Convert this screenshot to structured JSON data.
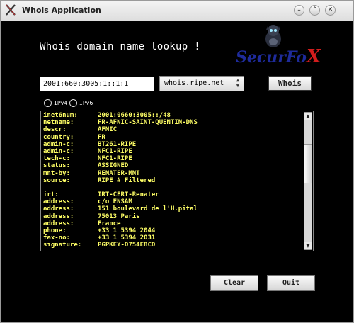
{
  "window": {
    "title": "Whois Application",
    "controls": {
      "minimize": "⌄",
      "maximize": "⌃",
      "close": "✕"
    }
  },
  "heading": "Whois domain name lookup !",
  "logo": {
    "text_main": "SecurFo",
    "text_x": "X"
  },
  "query": {
    "value": "2001:660:3005:1::1:1"
  },
  "server": {
    "selected": "whois.ripe.net"
  },
  "whois_label": "Whois",
  "radios": [
    {
      "label": "IPv4",
      "checked": false
    },
    {
      "label": "IPv6",
      "checked": false
    }
  ],
  "result_lines": [
    {
      "key": "inet6num:",
      "value": "2001:0660:3005::/48"
    },
    {
      "key": "netname:",
      "value": "FR-AFNIC-SAINT-QUENTIN-DNS"
    },
    {
      "key": "descr:",
      "value": "AFNIC"
    },
    {
      "key": "country:",
      "value": "FR"
    },
    {
      "key": "admin-c:",
      "value": "BT261-RIPE"
    },
    {
      "key": "admin-c:",
      "value": "NFC1-RIPE"
    },
    {
      "key": "tech-c:",
      "value": "NFC1-RIPE"
    },
    {
      "key": "status:",
      "value": "ASSIGNED"
    },
    {
      "key": "mnt-by:",
      "value": "RENATER-MNT"
    },
    {
      "key": "source:",
      "value": "RIPE # Filtered"
    },
    {
      "key": "",
      "value": ""
    },
    {
      "key": "irt:",
      "value": "IRT-CERT-Renater"
    },
    {
      "key": "address:",
      "value": "c/o ENSAM"
    },
    {
      "key": "address:",
      "value": "151 boulevard de l'H.pital"
    },
    {
      "key": "address:",
      "value": "75013 Paris"
    },
    {
      "key": "address:",
      "value": "France"
    },
    {
      "key": "phone:",
      "value": "+33 1 5394 2044"
    },
    {
      "key": "fax-no:",
      "value": "+33 1 5394 2031"
    },
    {
      "key": "signature:",
      "value": "PGPKEY-D754E8CD"
    }
  ],
  "buttons": {
    "clear": "Clear",
    "quit": "Quit"
  }
}
